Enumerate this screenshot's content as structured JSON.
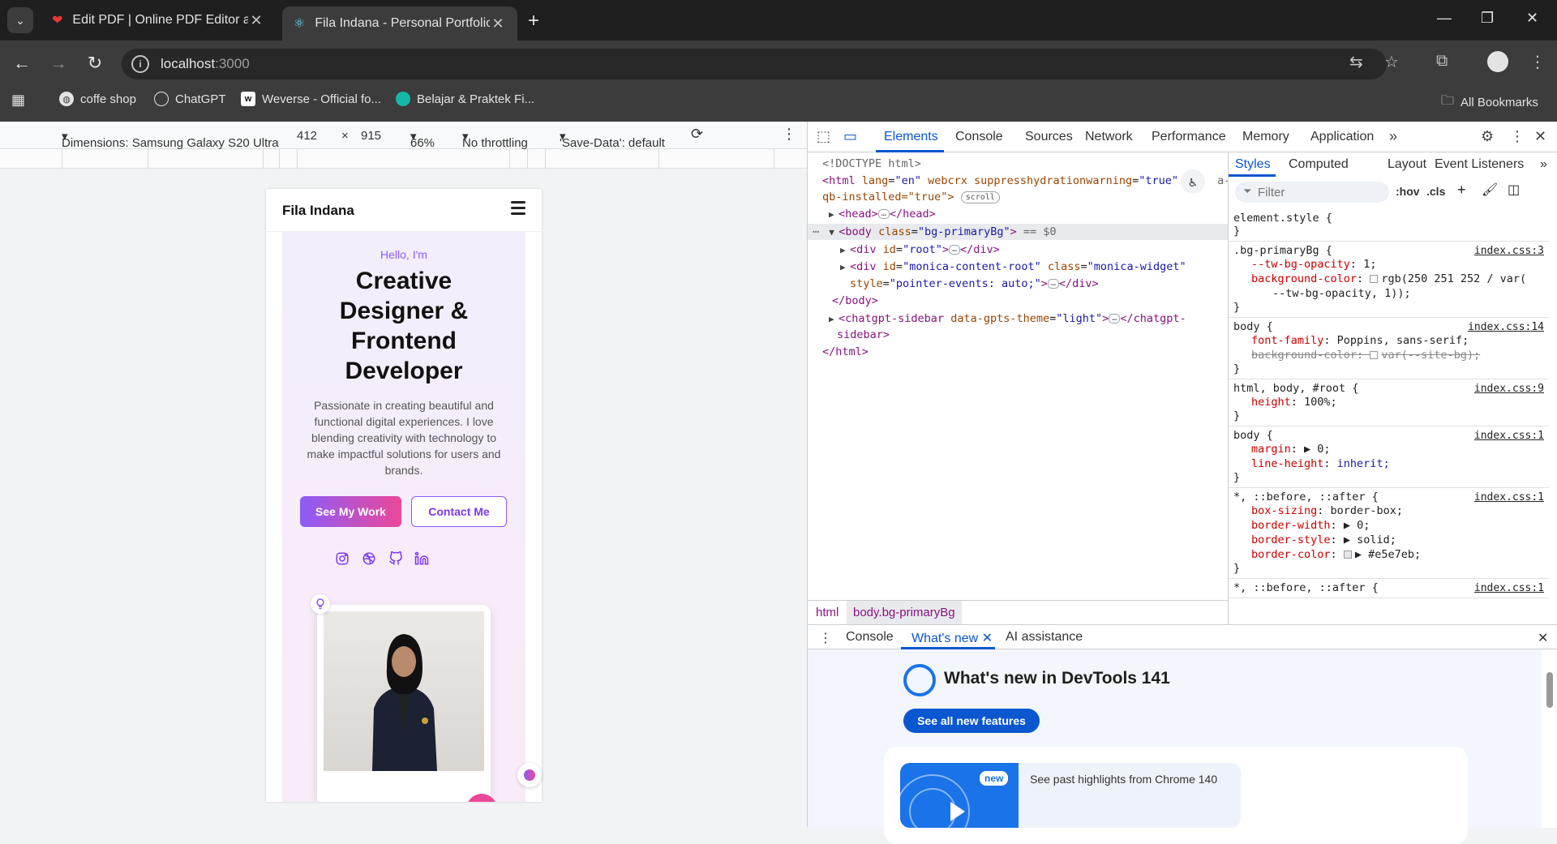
{
  "browser": {
    "tabs": [
      {
        "title": "Edit PDF | Online PDF Editor and",
        "active": false
      },
      {
        "title": "Fila Indana - Personal Portfolio",
        "active": true
      }
    ],
    "url_host": "localhost",
    "url_port": ":3000",
    "bookmarks": [
      "coffe shop",
      "ChatGPT",
      "Weverse - Official fo...",
      "Belajar & Praktek Fi..."
    ],
    "all_bookmarks": "All Bookmarks"
  },
  "device_toolbar": {
    "dimensions": "Dimensions: Samsung Galaxy S20 Ultra",
    "width": "412",
    "x": "×",
    "height": "915",
    "zoom": "66%",
    "throttling": "No throttling",
    "save_data": "'Save-Data': default"
  },
  "page": {
    "logo": "Fila Indana",
    "hello": "Hello, I'm",
    "headline_lines": [
      "Creative",
      "Designer &",
      "Frontend",
      "Developer"
    ],
    "description": "Passionate in creating beautiful and functional digital experiences. I love blending creativity with technology to make impactful solutions for users and brands.",
    "primary_button": "See My Work",
    "secondary_button": "Contact Me",
    "social_icons": [
      "instagram-icon",
      "dribbble-icon",
      "github-icon",
      "linkedin-icon"
    ],
    "accent": "#8b5cf6",
    "accent2": "#ec4899"
  },
  "devtools": {
    "tabs": [
      "Elements",
      "Console",
      "Sources",
      "Network",
      "Performance",
      "Memory",
      "Application"
    ],
    "active_tab": "Elements",
    "dom": {
      "doctype": "<!DOCTYPE html>",
      "html_open_tag": "<html",
      "html_lang_attr": "lang",
      "html_lang_val": "\"en\"",
      "html_attr2": "webcrx",
      "html_attr3": "suppresshydrationwarning",
      "html_attr3_val": "\"true\"",
      "html_attr4_tail": "a-",
      "html_line2": "qb-installed=\"true\">",
      "scroll_badge": "scroll",
      "head": "<head>",
      "head_close": "</head>",
      "body_open": "<body",
      "body_class_attr": "class",
      "body_class_val": "\"bg-primaryBg\"",
      "body_marker": "== $0",
      "root_div": "<div",
      "root_id_attr": "id",
      "root_id_val": "\"root\"",
      "div_close": "</div>",
      "monica_id_val": "\"monica-content-root\"",
      "monica_class_val": "\"monica-widget\"",
      "monica_style_attr": "style",
      "monica_style_val": "\"pointer-events: auto;\"",
      "body_close": "</body>",
      "chatgpt_open": "<chatgpt-sidebar",
      "chatgpt_attr": "data-gpts-theme",
      "chatgpt_val": "\"light\"",
      "chatgpt_close": "</chatgpt-",
      "chatgpt_close2": "sidebar>",
      "html_close": "</html>"
    },
    "breadcrumbs": [
      "html",
      "body.bg-primaryBg"
    ],
    "styles_tabs": [
      "Styles",
      "Computed",
      "Layout",
      "Event Listeners"
    ],
    "filter_placeholder": "Filter",
    "hov": ":hov",
    "cls": ".cls",
    "rules": [
      {
        "selector": "element.style {",
        "source": "",
        "decls": []
      },
      {
        "selector": ".bg-primaryBg {",
        "source": "index.css:3",
        "decls": [
          {
            "name": "--tw-bg-opacity",
            "value": "1;"
          },
          {
            "name": "background-color",
            "value": "rgb(250 251 252 / var(",
            "swatch": "#fafbfc"
          },
          {
            "name": "",
            "value": "--tw-bg-opacity, 1));"
          }
        ]
      },
      {
        "selector": "body {",
        "source": "index.css:14",
        "decls": [
          {
            "name": "font-family",
            "value": "Poppins, sans-serif;"
          },
          {
            "name": "background-color",
            "value": "var(--site-bg);",
            "struck": true,
            "swatch": "#ffffff"
          }
        ]
      },
      {
        "selector": "html, body, #root {",
        "source": "index.css:9",
        "decls": [
          {
            "name": "height",
            "value": "100%;"
          }
        ]
      },
      {
        "selector": "body {",
        "source": "index.css:1",
        "decls": [
          {
            "name": "margin",
            "value": "▶ 0;"
          },
          {
            "name": "line-height",
            "value": "inherit;"
          }
        ]
      },
      {
        "selector": "*, ::before, ::after {",
        "source": "index.css:1",
        "decls": [
          {
            "name": "box-sizing",
            "value": "border-box;"
          },
          {
            "name": "border-width",
            "value": "▶ 0;"
          },
          {
            "name": "border-style",
            "value": "▶ solid;"
          },
          {
            "name": "border-color",
            "value": "▶ #e5e7eb;",
            "swatch": "#e5e7eb"
          }
        ]
      },
      {
        "selector": "*, ::before, ::after {",
        "source": "index.css:1",
        "decls": []
      }
    ],
    "drawer": {
      "tabs": [
        "Console",
        "What's new",
        "AI assistance"
      ],
      "active_tab": "What's new",
      "title": "What's new in DevTools 141",
      "button": "See all new features",
      "new_badge": "new",
      "card_text": "See past highlights from Chrome 140"
    }
  }
}
